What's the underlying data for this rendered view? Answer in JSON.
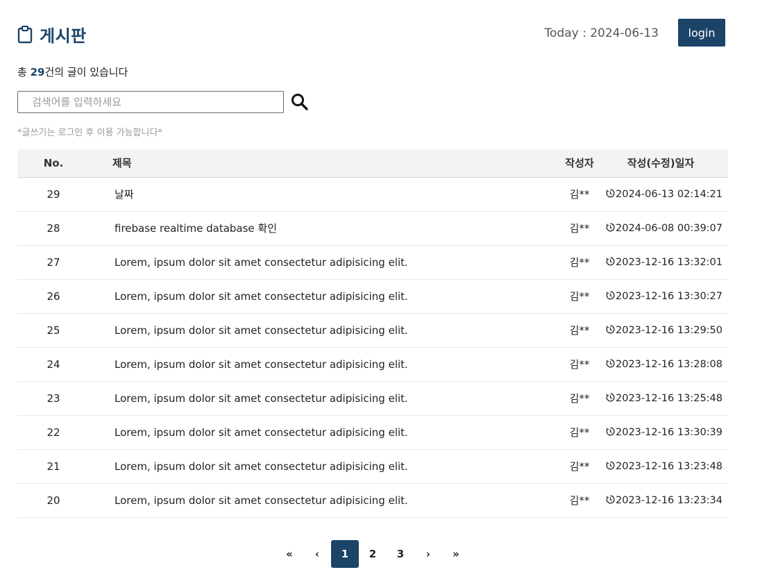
{
  "header": {
    "title": "게시판",
    "today": "Today : 2024-06-13",
    "login_label": "login"
  },
  "summary": {
    "prefix": "총 ",
    "count": "29",
    "suffix": "건의 글이 있습니다"
  },
  "search": {
    "placeholder": "검색어를 입력하세요",
    "value": ""
  },
  "notice": "*글쓰기는 로그인 후 이용 가능합니다*",
  "table": {
    "headers": {
      "no": "No.",
      "subject": "제목",
      "writer": "작성자",
      "date": "작성(수정)일자"
    },
    "rows": [
      {
        "no": "29",
        "subject": "날짜",
        "writer": "김**",
        "date": "2024-06-13 02:14:21"
      },
      {
        "no": "28",
        "subject": "firebase realtime database 확인",
        "writer": "김**",
        "date": "2024-06-08 00:39:07"
      },
      {
        "no": "27",
        "subject": "Lorem, ipsum dolor sit amet consectetur adipisicing elit.",
        "writer": "김**",
        "date": "2023-12-16 13:32:01"
      },
      {
        "no": "26",
        "subject": "Lorem, ipsum dolor sit amet consectetur adipisicing elit.",
        "writer": "김**",
        "date": "2023-12-16 13:30:27"
      },
      {
        "no": "25",
        "subject": "Lorem, ipsum dolor sit amet consectetur adipisicing elit.",
        "writer": "김**",
        "date": "2023-12-16 13:29:50"
      },
      {
        "no": "24",
        "subject": "Lorem, ipsum dolor sit amet consectetur adipisicing elit.",
        "writer": "김**",
        "date": "2023-12-16 13:28:08"
      },
      {
        "no": "23",
        "subject": "Lorem, ipsum dolor sit amet consectetur adipisicing elit.",
        "writer": "김**",
        "date": "2023-12-16 13:25:48"
      },
      {
        "no": "22",
        "subject": "Lorem, ipsum dolor sit amet consectetur adipisicing elit.",
        "writer": "김**",
        "date": "2023-12-16 13:30:39"
      },
      {
        "no": "21",
        "subject": "Lorem, ipsum dolor sit amet consectetur adipisicing elit.",
        "writer": "김**",
        "date": "2023-12-16 13:23:48"
      },
      {
        "no": "20",
        "subject": "Lorem, ipsum dolor sit amet consectetur adipisicing elit.",
        "writer": "김**",
        "date": "2023-12-16 13:23:34"
      }
    ]
  },
  "pagination": {
    "first": "«",
    "prev": "‹",
    "pages": [
      "1",
      "2",
      "3"
    ],
    "current": "1",
    "next": "›",
    "last": "»"
  },
  "colors": {
    "accent": "#1c4468",
    "header_bg": "#f2f3f5",
    "muted_text": "#999999"
  },
  "icons": {
    "title": "clipboard-icon",
    "search": "search-icon",
    "date": "clock-icon"
  }
}
